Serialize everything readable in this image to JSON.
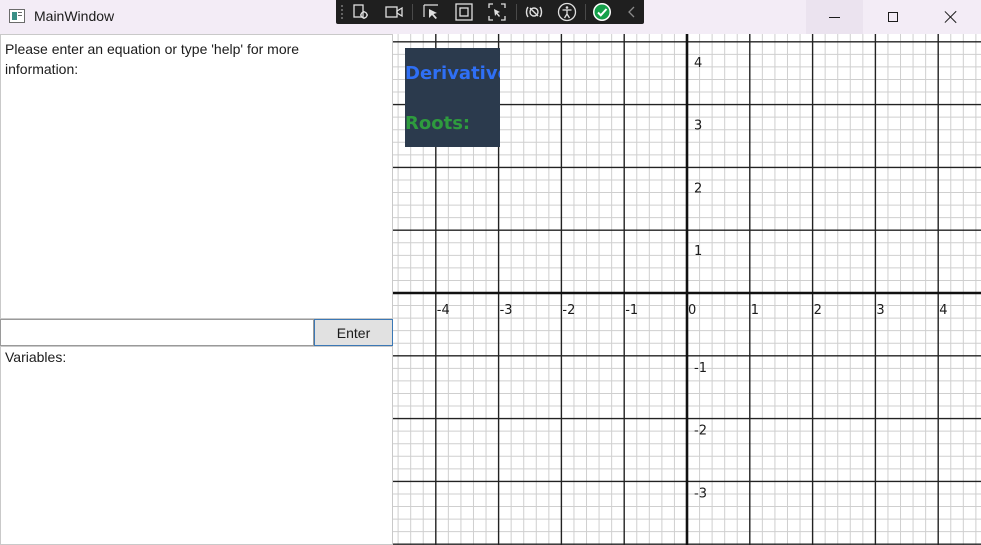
{
  "window": {
    "title": "MainWindow",
    "icon": "app-window-icon"
  },
  "debug_toolbar": {
    "icons": [
      "select-element-icon",
      "live-preview-icon",
      "pointer-select-icon",
      "display-adorners-icon",
      "track-focus-icon",
      "binding-failures-icon",
      "accessibility-icon",
      "check-mark-icon",
      "collapse-chevron-icon"
    ]
  },
  "output": {
    "text": "Please enter an equation or type 'help' for more information:"
  },
  "input": {
    "value": "",
    "placeholder": ""
  },
  "enter_button": {
    "label": "Enter"
  },
  "variables": {
    "label": "Variables:"
  },
  "info_box": {
    "derivative_label": "Derivative:",
    "roots_label": "Roots:",
    "derivative_color": "#2f6ff5",
    "roots_color": "#2e9b3e",
    "background": "#2b3a4d"
  },
  "graph": {
    "x_ticks": [
      "-4",
      "-3",
      "-2",
      "-1",
      "0",
      "1",
      "2",
      "3",
      "4"
    ],
    "y_ticks_positive": [
      "4",
      "3",
      "2",
      "1"
    ],
    "y_ticks_negative": [
      "-1",
      "-2",
      "-3"
    ],
    "minor_divisions_per_unit": 5,
    "x_range": [
      -4.7,
      4.6
    ],
    "y_range": [
      -4,
      4.1
    ]
  }
}
